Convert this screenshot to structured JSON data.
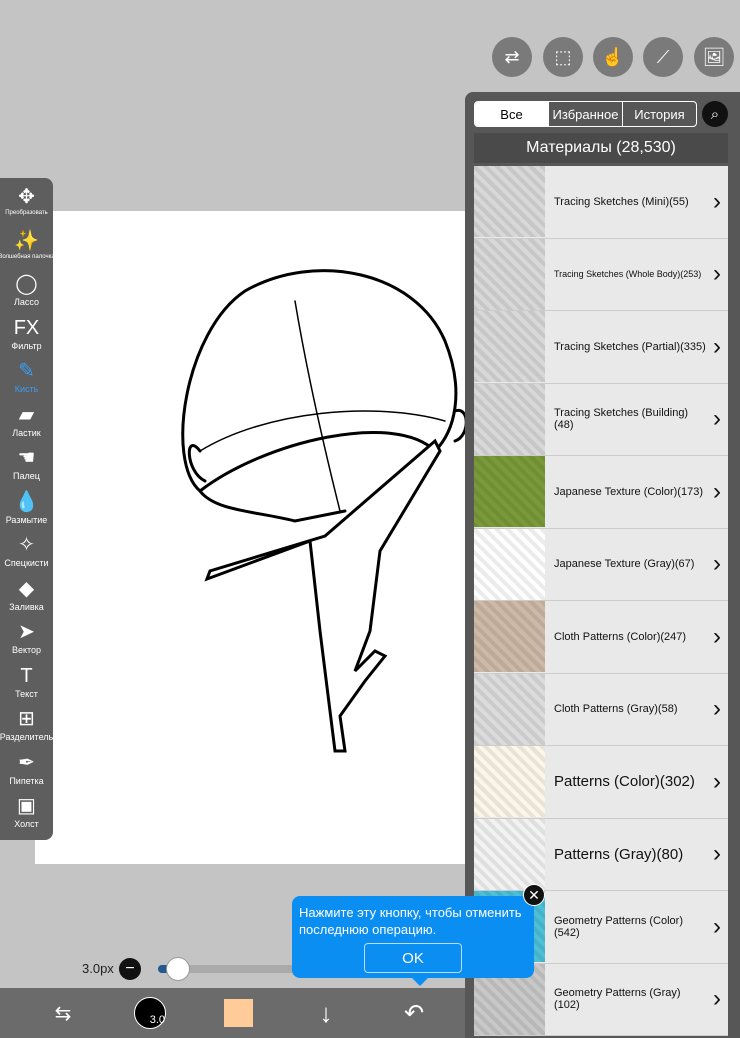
{
  "toolbar": {
    "items": [
      {
        "icon": "move-icon",
        "glyph": "✥",
        "label": "Преобразовать",
        "small": true
      },
      {
        "icon": "magic-wand-icon",
        "glyph": "✨",
        "label": "Волшебная палочка",
        "small": true
      },
      {
        "icon": "lasso-icon",
        "glyph": "◯",
        "label": "Лассо"
      },
      {
        "icon": "fx-icon",
        "glyph": "FX",
        "label": "Фильтр"
      },
      {
        "icon": "brush-icon",
        "glyph": "✎",
        "label": "Кисть",
        "active": true
      },
      {
        "icon": "eraser-icon",
        "glyph": "▰",
        "label": "Ластик"
      },
      {
        "icon": "finger-icon",
        "glyph": "☚",
        "label": "Палец"
      },
      {
        "icon": "blur-drop-icon",
        "glyph": "💧",
        "label": "Размытие"
      },
      {
        "icon": "special-brush-icon",
        "glyph": "✧",
        "label": "Спецкисти"
      },
      {
        "icon": "fill-bucket-icon",
        "glyph": "◆",
        "label": "Заливка"
      },
      {
        "icon": "vector-arrow-icon",
        "glyph": "➤",
        "label": "Вектор"
      },
      {
        "icon": "text-icon",
        "glyph": "T",
        "label": "Текст"
      },
      {
        "icon": "frame-divider-icon",
        "glyph": "⊞",
        "label": "Разделитель"
      },
      {
        "icon": "eyedropper-icon",
        "glyph": "✒",
        "label": "Пипетка"
      },
      {
        "icon": "canvas-icon",
        "glyph": "▣",
        "label": "Холст"
      }
    ]
  },
  "top_buttons": [
    {
      "icon": "toggle-icon",
      "glyph": "⇄"
    },
    {
      "icon": "selection-icon",
      "glyph": "⬚"
    },
    {
      "icon": "hand-icon",
      "glyph": "☝"
    },
    {
      "icon": "ruler-icon",
      "glyph": "⟋"
    },
    {
      "icon": "material-image-icon",
      "glyph": "🖼"
    }
  ],
  "panel": {
    "tabs": [
      "Все",
      "Избранное",
      "История"
    ],
    "selected_tab": 0,
    "title": "Материалы (28,530)",
    "items": [
      {
        "label": "Tracing Sketches (Mini)(55)",
        "thumb": "#d8d8d8"
      },
      {
        "label": "Tracing Sketches (Whole Body)(253)",
        "thumb": "#d8d8d8",
        "size": "tiny"
      },
      {
        "label": "Tracing Sketches (Partial)(335)",
        "thumb": "#d8d8d8"
      },
      {
        "label": "Tracing Sketches (Building)(48)",
        "thumb": "#d8d8d8"
      },
      {
        "label": "Japanese Texture (Color)(173)",
        "thumb": "#7a9a3a"
      },
      {
        "label": "Japanese Texture (Gray)(67)",
        "thumb": "#ffffff"
      },
      {
        "label": "Cloth Patterns (Color)(247)",
        "thumb": "#cdb9a5"
      },
      {
        "label": "Cloth Patterns (Gray)(58)",
        "thumb": "#dcdcdc"
      },
      {
        "label": "Patterns (Color)(302)",
        "thumb": "#fbf6e8",
        "size": "big"
      },
      {
        "label": "Patterns (Gray)(80)",
        "thumb": "#f2f2f2",
        "size": "big"
      },
      {
        "label": "Geometry Patterns (Color)(542)",
        "thumb": "#4cc0d8"
      },
      {
        "label": "Geometry Patterns (Gray)(102)",
        "thumb": "#c8c8c8"
      }
    ]
  },
  "brush": {
    "size_label": "3.0px",
    "size_badge": "3.0",
    "slider_value": 0.05
  },
  "color": "#ffcb99",
  "tooltip": {
    "text": "Нажмите эту кнопку, чтобы отменить последнюю операцию.",
    "ok": "OK"
  },
  "accent": "#0b8ef2"
}
